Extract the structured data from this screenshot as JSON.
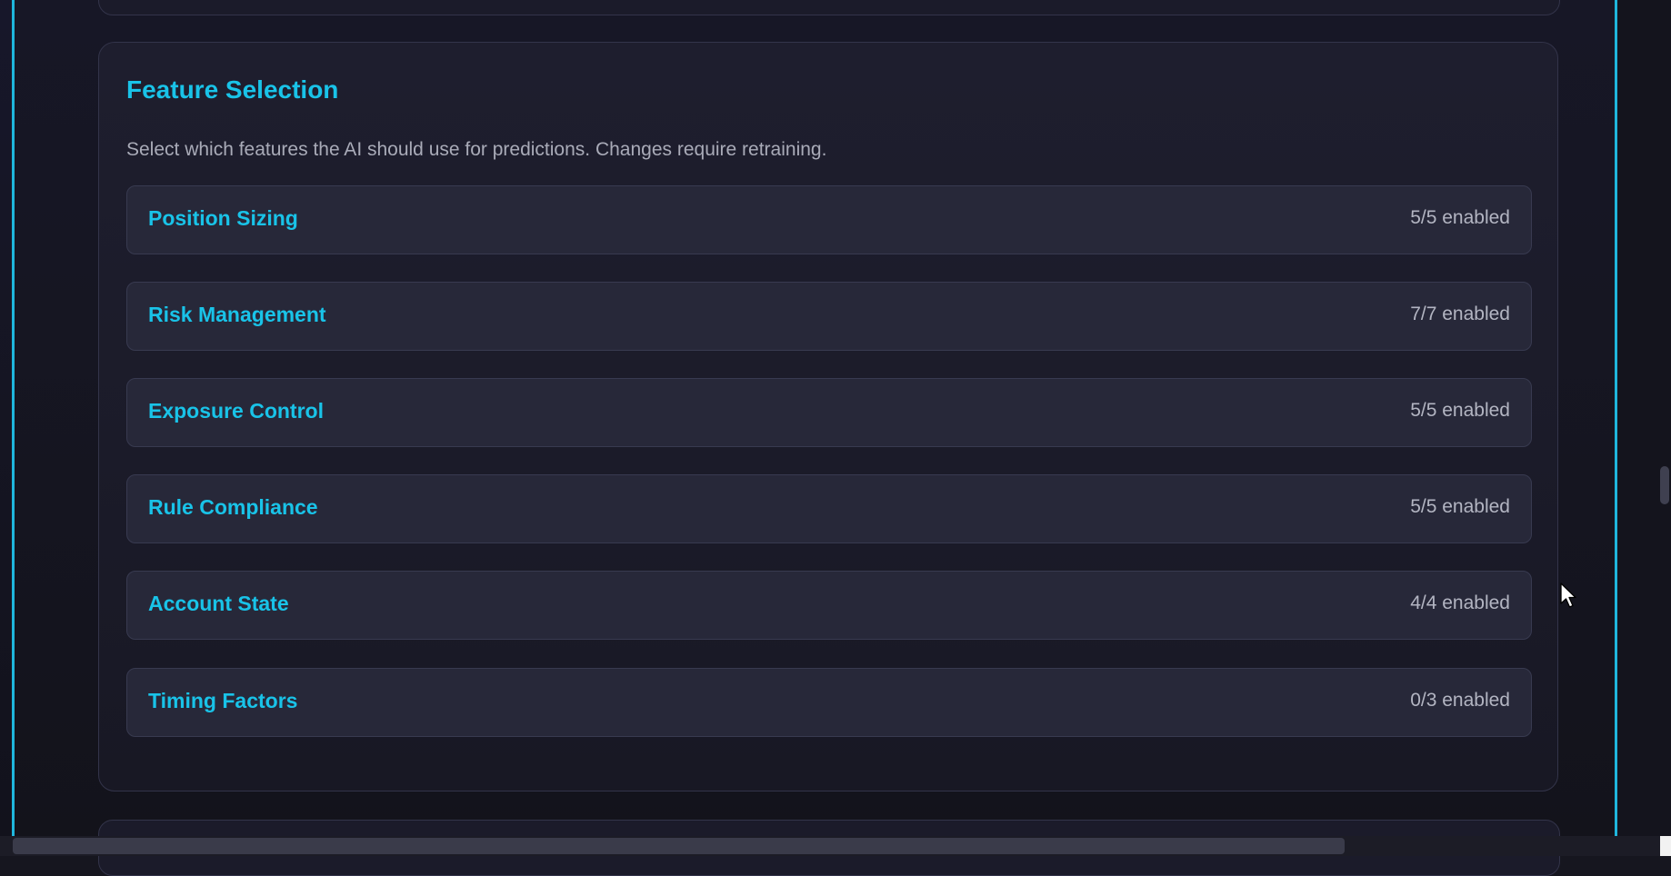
{
  "feature_selection": {
    "title": "Feature Selection",
    "description": "Select which features the AI should use for predictions. Changes require retraining.",
    "groups": [
      {
        "name": "Position Sizing",
        "status": "5/5 enabled"
      },
      {
        "name": "Risk Management",
        "status": "7/7 enabled"
      },
      {
        "name": "Exposure Control",
        "status": "5/5 enabled"
      },
      {
        "name": "Rule Compliance",
        "status": "5/5 enabled"
      },
      {
        "name": "Account State",
        "status": "4/4 enabled"
      },
      {
        "name": "Timing Factors",
        "status": "0/3 enabled"
      }
    ]
  },
  "colors": {
    "accent": "#19c3e8",
    "frame_line": "#1fb6dc",
    "card_background": "#1e1e2e",
    "group_background": "#272839",
    "muted_text": "#b3b5c2"
  },
  "icons": {
    "cursor": "mouse-pointer-icon"
  }
}
